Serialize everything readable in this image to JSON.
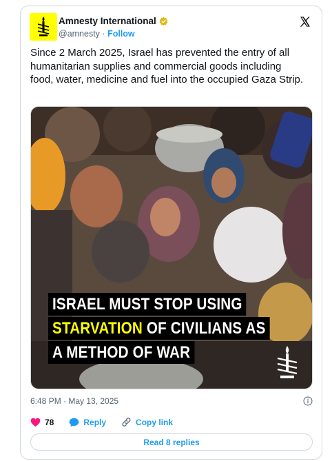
{
  "author": {
    "name": "Amnesty International",
    "handle": "@amnesty",
    "separator": "·",
    "follow_label": "Follow"
  },
  "post": {
    "text": "Since 2 March 2025,  Israel has prevented the entry of all humanitarian supplies and commercial goods including food, water, medicine and fuel into the occupied Gaza Strip."
  },
  "media": {
    "banner_line1": "ISRAEL MUST STOP USING",
    "banner_line2_highlight": "STARVATION",
    "banner_line2_rest": " OF CIVILIANS AS",
    "banner_line3": "A METHOD OF WAR",
    "highlight_color": "#ffff00"
  },
  "meta": {
    "timestamp": "6:48 PM · May 13, 2025"
  },
  "actions": {
    "like_count": "78",
    "reply_label": "Reply",
    "copy_label": "Copy link",
    "read_replies_label": "Read 8 replies"
  },
  "colors": {
    "accent": "#1d9bf0",
    "like": "#f91880",
    "avatar_bg": "#ffff00",
    "verified": "#e2b719"
  },
  "icons": [
    "amnesty-candle-logo",
    "verified-badge-icon",
    "x-logo-icon",
    "info-icon",
    "heart-icon",
    "reply-bubble-icon",
    "link-icon"
  ]
}
